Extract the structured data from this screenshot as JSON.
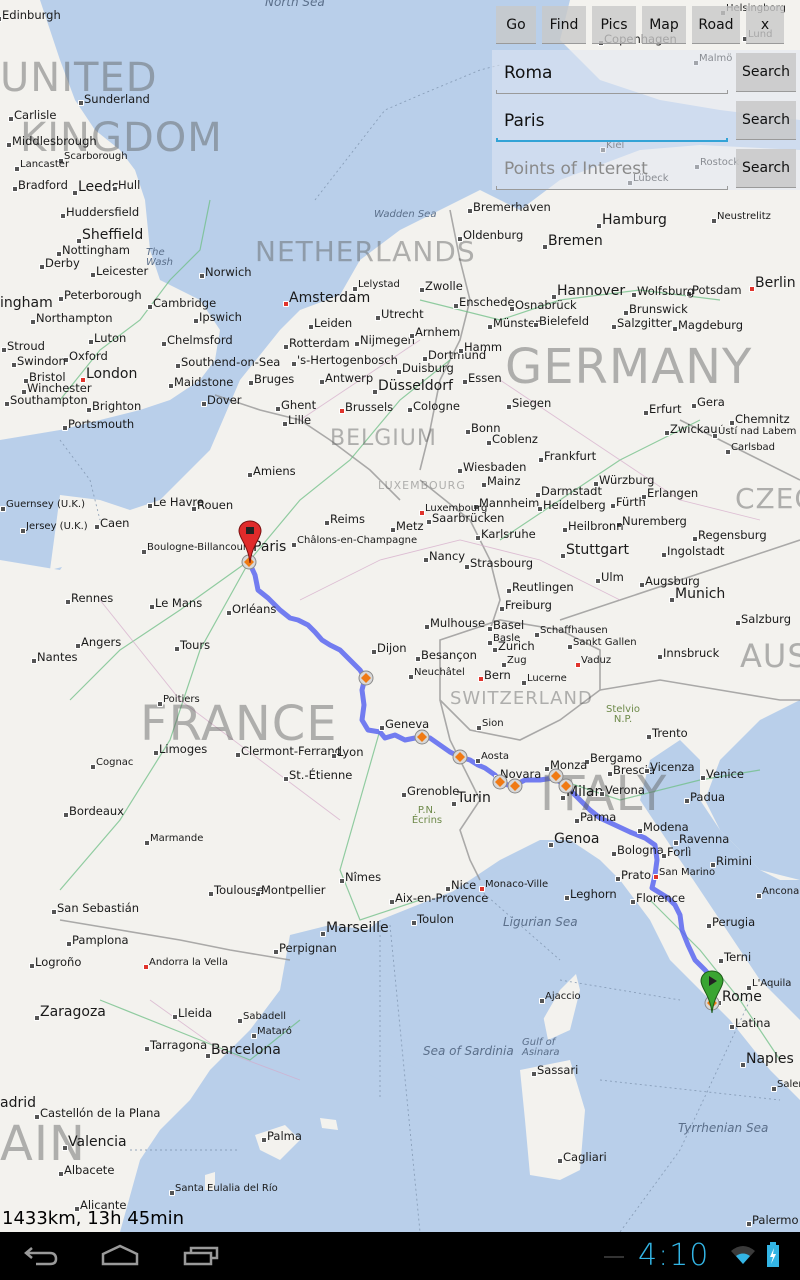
{
  "toolbar": {
    "buttons": [
      {
        "label": "Go"
      },
      {
        "label": "Find"
      },
      {
        "label": "Pics"
      },
      {
        "label": "Map"
      },
      {
        "label": "Road"
      },
      {
        "label": "x"
      }
    ]
  },
  "search": {
    "fields": [
      {
        "value": "Roma",
        "placeholder": "",
        "button": "Search"
      },
      {
        "value": "Paris",
        "placeholder": "",
        "button": "Search",
        "focused": true
      },
      {
        "value": "",
        "placeholder": "Points of Interest",
        "button": "Search"
      }
    ]
  },
  "route": {
    "summary": "1433km, 13h 45min",
    "color": "#5b67f0",
    "start_pin_color": "#e02b2b",
    "end_pin_color": "#3aa532",
    "waypoint_color": "#f07a14"
  },
  "map": {
    "countries": [
      "UNITED",
      "KINGDOM",
      "NETHERLANDS",
      "GERMANY",
      "BELGIUM",
      "LUXEMBOURG",
      "FRANCE",
      "SWITZERLAND",
      "ITALY",
      "CZEC",
      "AUS",
      "AIN"
    ],
    "seas": [
      "North Sea",
      "Wadden Sea",
      "Ligurian Sea",
      "Sea of Sardinia",
      "Gulf of Asinara",
      "Tyrrhenian Sea",
      "The Wash"
    ],
    "parks": [
      "Stelvio N.P.",
      "P.N. Écrins"
    ],
    "cities": {
      "large": [
        "Leeds",
        "Sheffield",
        "London",
        "Amsterdam",
        "Düsseldorf",
        "Hamburg",
        "Bremen",
        "Hannover",
        "Berlin",
        "Stuttgart",
        "Munich",
        "Paris",
        "Turin",
        "Milan",
        "Genoa",
        "Marseille",
        "Barcelona",
        "Zaragoza",
        "Valencia",
        "Naples",
        "Rome",
        "Copenhagen",
        "adrid",
        "ingham"
      ],
      "medium": [
        "Edinburgh",
        "Sunderland",
        "Carlisle",
        "Middlesbrough",
        "Scarborough",
        "Lancaster",
        "Bradford",
        "Hull",
        "Huddersfield",
        "Nottingham",
        "Derby",
        "Leicester",
        "Peterborough",
        "Norwich",
        "Cambridge",
        "Northampton",
        "Ipswich",
        "Luton",
        "Chelmsford",
        "Oxford",
        "Swindon",
        "Bristol",
        "Winchester",
        "Southampton",
        "Brighton",
        "Portsmouth",
        "Maidstone",
        "Dover",
        "Southend-on-Sea",
        "Bruges",
        "Ghent",
        "Lille",
        "Brussels",
        "Antwerp",
        "Rotterdam",
        "'s-Hertogenbosch",
        "Leiden",
        "Utrecht",
        "Nijmegen",
        "Arnhem",
        "Zwolle",
        "Dortmund",
        "Duisburg",
        "Essen",
        "Cologne",
        "Bonn",
        "Siegen",
        "Coblenz",
        "Frankfurt",
        "Wiesbaden",
        "Mainz",
        "Darmstadt",
        "Würzburg",
        "Mannheim",
        "Heidelberg",
        "Fürth",
        "Erlangen",
        "Nuremberg",
        "Heilbronn",
        "Karlsruhe",
        "Saarbrücken",
        "Metz",
        "Nancy",
        "Strasbourg",
        "Reutlingen",
        "Ulm",
        "Augsburg",
        "Ingolstadt",
        "Regensburg",
        "Freiburg",
        "Basel",
        "Zurich",
        "Bern",
        "Innsbruck",
        "Salzburg",
        "Erfurt",
        "Gera",
        "Chemnitz",
        "Magdeburg",
        "Potsdam",
        "Hamm",
        "Münster",
        "Bielefeld",
        "Osnabrück",
        "Oldenburg",
        "Bremerhaven",
        "Enschede",
        "Siegen",
        "Amiens",
        "Rouen",
        "Le Havre",
        "Caen",
        "Reims",
        "Rennes",
        "Le Mans",
        "Orléans",
        "Angers",
        "Tours",
        "Nantes",
        "Dijon",
        "Besançon",
        "Mulhouse",
        "Limoges",
        "Clermont-Ferrand",
        "Lyon",
        "St.-Étienne",
        "Geneva",
        "Grenoble",
        "Bordeaux",
        "Toulouse",
        "Montpellier",
        "Nîmes",
        "Nice",
        "Aix-en-Provence",
        "Toulon",
        "Perpignan",
        "San Sebastián",
        "Pamplona",
        "Logroño",
        "Lleida",
        "Tarragona",
        "Palma",
        "Albacete",
        "Alicante",
        "Bergamo",
        "Brescia",
        "Vicenza",
        "Venice",
        "Verona",
        "Padua",
        "Trento",
        "Monza",
        "Novara",
        "Parma",
        "Modena",
        "Bologna",
        "Ravenna",
        "Forlì",
        "Rimini",
        "Prato",
        "Florence",
        "Leghorn",
        "Perugia",
        "Terni",
        "Ancona",
        "Latina",
        "Sassari",
        "Cagliari",
        "Ajaccio",
        "Palermo",
        "Castellón de la Plana",
        "Salzgitter",
        "Brunswick",
        "Wolfsburg",
        "Sankt Gallen"
      ],
      "small": [
        "Lelystad",
        "Neustrelitz",
        "Helsingborg",
        "Malmö",
        "Lund",
        "Kiel",
        "Rostock",
        "Lübeck",
        "Zwickau",
        "Ústí nad Labem",
        "Carlsbad",
        "Luxembourg",
        "Châlons-en-Champagne",
        "Boulogne-Billancourt",
        "Poitiers",
        "Cognac",
        "Marmande",
        "Neuchâtel",
        "Basle",
        "Schaffhausen",
        "Zug",
        "Lucerne",
        "Vaduz",
        "Sion",
        "Aosta",
        "Andorra la Vella",
        "Monaco-Ville",
        "Sabadell",
        "Mataró",
        "Santa Eulalia del Río",
        "San Marino",
        "L'Aquila",
        "Salerno",
        "Guernsey (U.K.)",
        "Jersey (U.K.)",
        "Stroud",
        "Oxford"
      ]
    }
  },
  "status_bar": {
    "time": "4:10",
    "wifi": "wifi-icon",
    "battery": "battery-charging-icon"
  },
  "nav": {
    "back": "back-icon",
    "home": "home-icon",
    "recents": "recent-apps-icon"
  }
}
